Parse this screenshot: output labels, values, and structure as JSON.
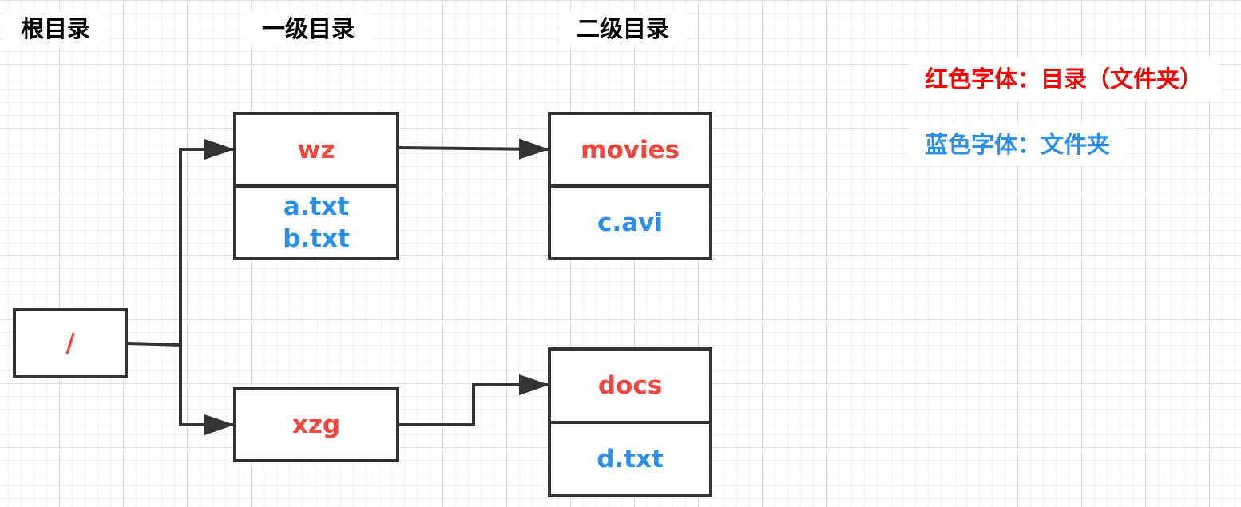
{
  "headers": {
    "root": "根目录",
    "level1": "一级目录",
    "level2": "二级目录"
  },
  "nodes": {
    "root": {
      "name": "/"
    },
    "wz": {
      "name": "wz",
      "files": [
        "a.txt",
        "b.txt"
      ]
    },
    "xzg": {
      "name": "xzg"
    },
    "movies": {
      "name": "movies",
      "files": [
        "c.avi"
      ]
    },
    "docs": {
      "name": "docs",
      "files": [
        "d.txt"
      ]
    }
  },
  "legend": {
    "red": "红色字体：目录（文件夹）",
    "blue": "蓝色字体：文件夹"
  },
  "colors": {
    "directory": "#f0463c",
    "file": "#2a8fea",
    "legend_red": "#ff0000",
    "line": "#333333"
  }
}
